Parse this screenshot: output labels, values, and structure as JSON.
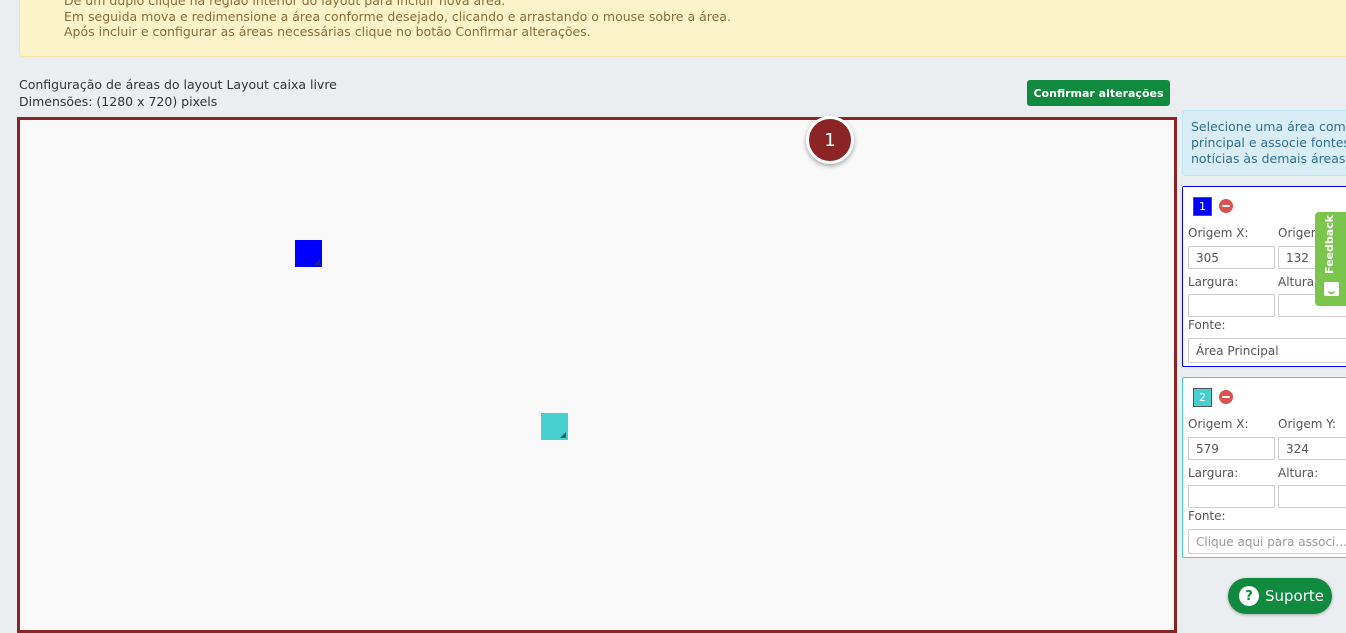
{
  "banner": {
    "lines": [
      "Dê um duplo clique na região interior do layout para incluir nova área.",
      "Em seguida mova e redimensione a área conforme desejado, clicando e arrastando o mouse sobre a área.",
      "Após incluir e configurar as áreas necessárias clique no botão Confirmar alterações."
    ]
  },
  "header": {
    "title": "Configuração de áreas do layout Layout caixa livre",
    "dimensions": "Dimensões: (1280 x 720) pixels",
    "confirm_label": "Confirmar alterações"
  },
  "canvas": {
    "step_badge": "1",
    "areas": [
      {
        "id": "1",
        "color": "#0000ff"
      },
      {
        "id": "2",
        "color": "#48cfcf"
      }
    ]
  },
  "panel": {
    "hint_lines": [
      "Selecione uma área como",
      "principal e associe fontes de",
      "notícias às demais áreas"
    ],
    "cards": [
      {
        "number": "1",
        "origin_x_label": "Origem X:",
        "origin_y_label": "Origem Y:",
        "origin_x": "305",
        "origin_y": "132",
        "width_label": "Largura:",
        "height_label": "Altura:",
        "width": "",
        "height": "",
        "source_label": "Fonte:",
        "source_value": "Área Principal",
        "source_placeholder": ""
      },
      {
        "number": "2",
        "origin_x_label": "Origem X:",
        "origin_y_label": "Origem Y:",
        "origin_x": "579",
        "origin_y": "324",
        "width_label": "Largura:",
        "height_label": "Altura:",
        "width": "",
        "height": "",
        "source_label": "Fonte:",
        "source_value": "",
        "source_placeholder": "Clique aqui para associ..."
      }
    ]
  },
  "feedback_label": "Feedback",
  "support_label": "Suporte",
  "colors": {
    "confirm_green": "#0f8a3f",
    "canvas_border": "#8b2525",
    "banner_bg": "#fcf3cb"
  }
}
